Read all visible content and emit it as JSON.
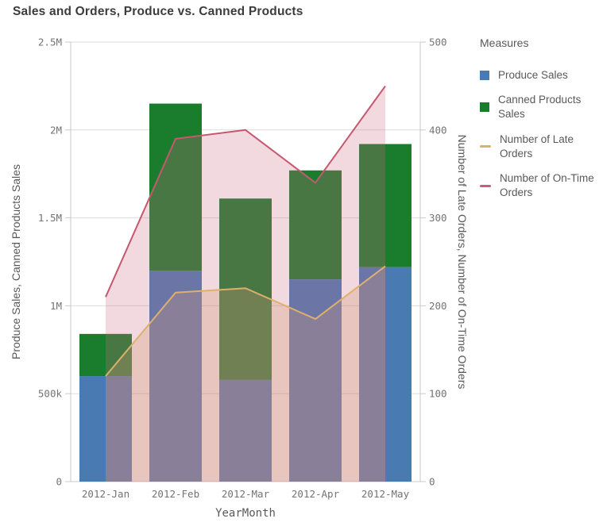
{
  "title": "Sales and Orders, Produce vs. Canned Products",
  "legend": {
    "title": "Measures",
    "items": [
      {
        "label": "Produce Sales",
        "color": "#4a7ab2",
        "swatch": "square"
      },
      {
        "label": "Canned Products Sales",
        "color": "#1a7d2e",
        "swatch": "square"
      },
      {
        "label": "Number of Late Orders",
        "color": "#d9b06c",
        "swatch": "line"
      },
      {
        "label": "Number of On-Time Orders",
        "color": "#c75d78",
        "swatch": "line"
      }
    ]
  },
  "chart_data": {
    "type": "combo-bar-line",
    "categories": [
      "2012-Jan",
      "2012-Feb",
      "2012-Mar",
      "2012-Apr",
      "2012-May"
    ],
    "x_axis_title": "YearMonth",
    "left_axis": {
      "title": "Produce Sales, Canned Products Sales",
      "tick_labels": [
        "0",
        "500k",
        "1M",
        "1.5M",
        "2M",
        "2.5M"
      ],
      "max": 2500000
    },
    "right_axis": {
      "title": "Number of Late Orders, Number of On-Time Orders",
      "tick_labels": [
        "0",
        "100",
        "200",
        "300",
        "400",
        "500"
      ],
      "max": 500
    },
    "series": [
      {
        "name": "Produce Sales",
        "type": "bar-stack",
        "axis": "left",
        "color": "#4a7ab2",
        "values": [
          600000,
          1200000,
          580000,
          1150000,
          1220000
        ]
      },
      {
        "name": "Canned Products Sales",
        "type": "bar-stack",
        "axis": "left",
        "color": "#1a7d2e",
        "values": [
          240000,
          950000,
          1030000,
          620000,
          700000
        ]
      },
      {
        "name": "Number of Late Orders",
        "type": "area-line",
        "axis": "right",
        "color": "#ddb06c",
        "fill": "#d6a973",
        "fill_opacity": 0.29,
        "values": [
          120,
          215,
          220,
          185,
          245
        ]
      },
      {
        "name": "Number of On-Time Orders",
        "type": "area-line",
        "axis": "right",
        "color": "#c5586f",
        "fill": "#ce6782",
        "fill_opacity": 0.26,
        "values": [
          210,
          390,
          400,
          340,
          450
        ]
      }
    ],
    "grid": "horizontal",
    "legend_position": "right",
    "bar_stack_totals": [
      840000,
      2150000,
      1610000,
      1770000,
      1920000
    ]
  },
  "ui_colors": {
    "title_text": "#3c3c3c",
    "axis_text": "#737373",
    "label_text": "#595959",
    "gridline": "#dcdcdc",
    "axis_line": "#c9c9c9"
  }
}
